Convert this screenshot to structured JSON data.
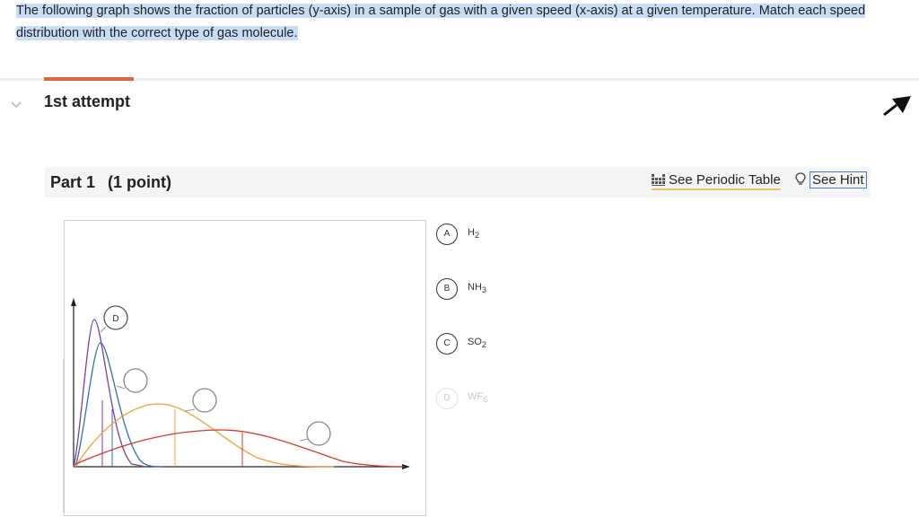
{
  "question": {
    "line1": "The following graph shows the fraction of particles (y-axis) in a sample of gas with a given speed (x-axis) at a given temperature.  Match each speed",
    "line2": "distribution with the correct type of gas molecule."
  },
  "attempt": {
    "label": "1st attempt"
  },
  "part": {
    "title": "Part 1",
    "points": "(1 point)"
  },
  "tools": {
    "periodic_table": "See Periodic Table",
    "hint": "See Hint"
  },
  "graph": {
    "placed_marker": "D",
    "curve_colors": [
      "#7b3fa2",
      "#2f6fb0",
      "#f0a030",
      "#d43a2a"
    ]
  },
  "choices": [
    {
      "letter": "A",
      "formula_main": "H",
      "formula_sub": "2",
      "state": "available"
    },
    {
      "letter": "B",
      "formula_main": "NH",
      "formula_sub": "3",
      "state": "available"
    },
    {
      "letter": "C",
      "formula_main": "SO",
      "formula_sub": "2",
      "state": "available"
    },
    {
      "letter": "D",
      "formula_main": "WF",
      "formula_sub": "6",
      "state": "placed"
    }
  ]
}
